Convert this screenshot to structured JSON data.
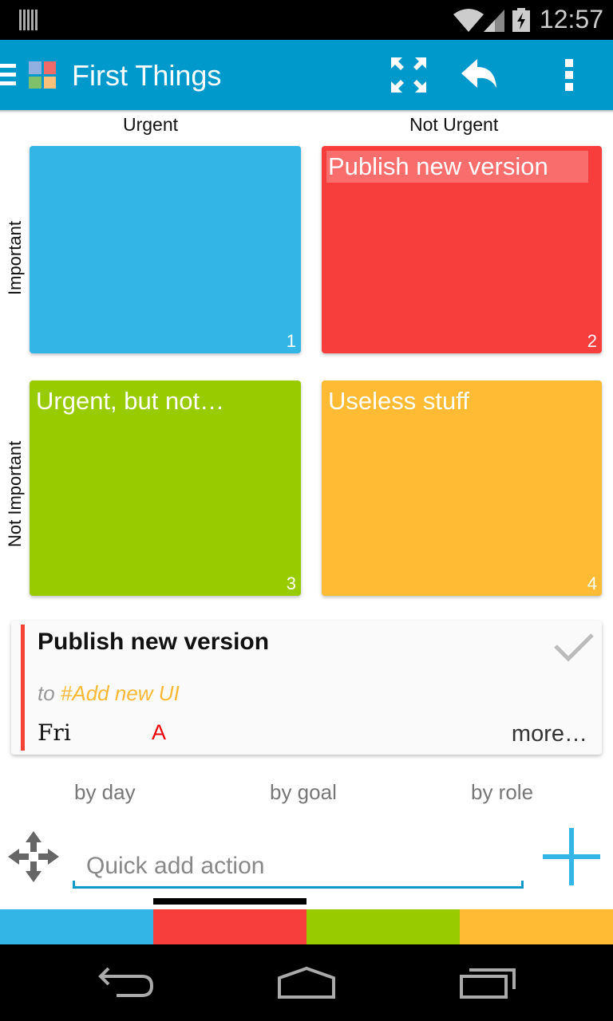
{
  "status_bar": {
    "time": "12:57"
  },
  "action_bar": {
    "title": "First Things",
    "logo_colors": [
      "#8fb0e0",
      "#f06a6a",
      "#7fc06a",
      "#fbc17a"
    ],
    "background": "#0099cc"
  },
  "matrix": {
    "column_labels": [
      "Urgent",
      "Not Urgent"
    ],
    "row_labels": [
      "Important",
      "Not Important"
    ],
    "quadrants": [
      {
        "title": "",
        "number": "1",
        "color": "#33b5e5",
        "highlighted": false
      },
      {
        "title": "Publish new version",
        "number": "2",
        "color": "#f83d3d",
        "highlighted": true
      },
      {
        "title": "Urgent, but not…",
        "number": "3",
        "color": "#99cc00",
        "highlighted": false
      },
      {
        "title": "Useless stuff",
        "number": "4",
        "color": "#ffbb33",
        "highlighted": false
      }
    ]
  },
  "task_card": {
    "title": "Publish new version",
    "goal_prefix": "to",
    "goal": "#Add new UI",
    "day": "Fri",
    "priority": "A",
    "more_label": "more…",
    "accent": "#f44336"
  },
  "filters": [
    "by day",
    "by goal",
    "by role"
  ],
  "quick_add": {
    "placeholder": "Quick add action",
    "value": ""
  },
  "tab_colors": [
    "#33b5e5",
    "#f83d3d",
    "#99cc00",
    "#ffbb33"
  ],
  "selected_tab_index": 1
}
